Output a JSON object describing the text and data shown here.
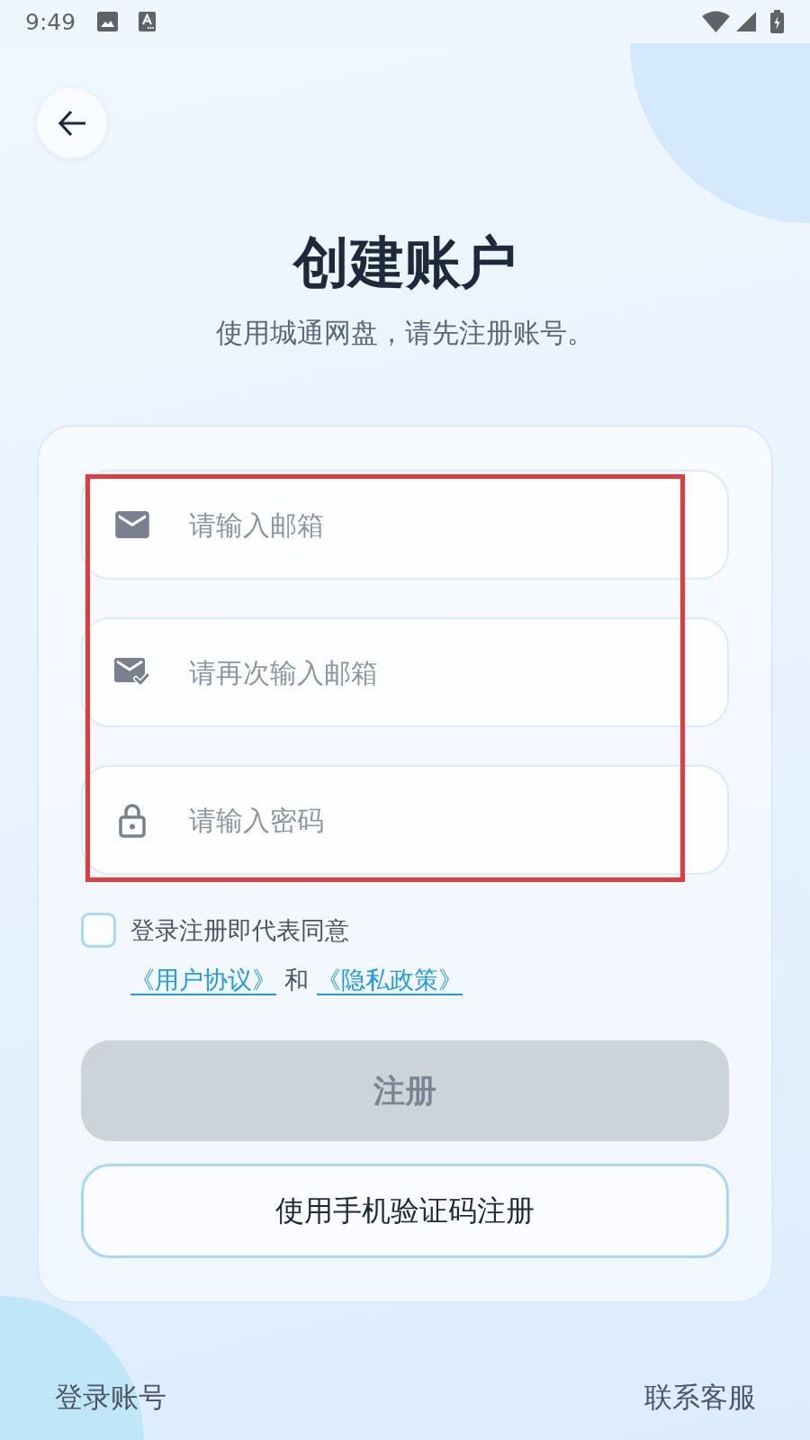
{
  "status_bar": {
    "time": "9:49"
  },
  "header": {
    "title": "创建账户",
    "subtitle": "使用城通网盘，请先注册账号。"
  },
  "form": {
    "fields": [
      {
        "kind": "email",
        "placeholder": "请输入邮箱"
      },
      {
        "kind": "email_confirm",
        "placeholder": "请再次输入邮箱"
      },
      {
        "kind": "password",
        "placeholder": "请输入密码"
      }
    ],
    "agreement": {
      "checked": false,
      "text": "登录注册即代表同意",
      "links": [
        "《用户协议》",
        "《隐私政策》"
      ],
      "conjunction": "和"
    },
    "buttons": [
      {
        "kind": "primary",
        "label": "注册",
        "disabled": true
      },
      {
        "kind": "outline",
        "label": "使用手机验证码注册",
        "disabled": false
      }
    ]
  },
  "footer": {
    "links": [
      "登录账号",
      "联系客服"
    ]
  }
}
